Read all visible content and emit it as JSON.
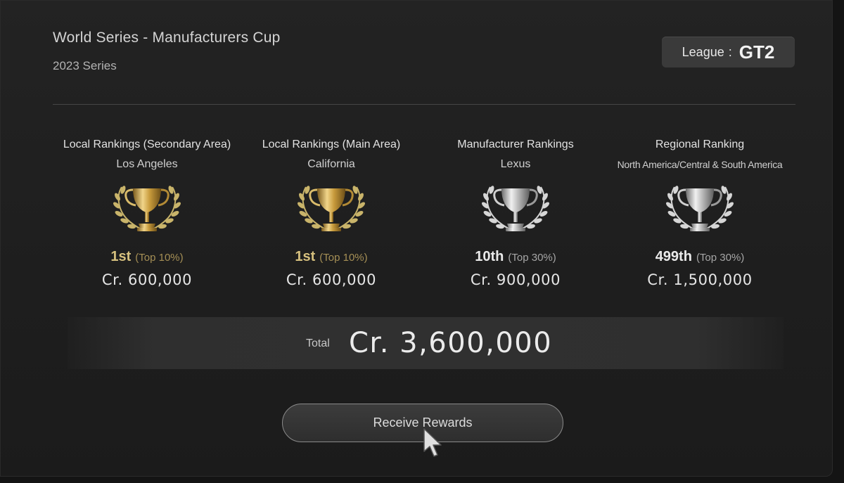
{
  "header": {
    "title": "World Series - Manufacturers Cup",
    "subtitle": "2023 Series",
    "league_label": "League",
    "league_colon": ":",
    "league_value": "GT2"
  },
  "rankings": [
    {
      "heading": "Local Rankings (Secondary Area)",
      "area": "Los Angeles",
      "trophy": "gold-trophy-icon",
      "position": "1st",
      "percentile": "(Top 10%)",
      "reward": "Cr. 600,000"
    },
    {
      "heading": "Local Rankings (Main Area)",
      "area": "California",
      "trophy": "gold-trophy-icon",
      "position": "1st",
      "percentile": "(Top 10%)",
      "reward": "Cr. 600,000"
    },
    {
      "heading": "Manufacturer Rankings",
      "area": "Lexus",
      "trophy": "silver-trophy-icon",
      "position": "10th",
      "percentile": "(Top 30%)",
      "reward": "Cr. 900,000"
    },
    {
      "heading": "Regional Ranking",
      "area": "North America/Central & South America",
      "trophy": "silver-trophy-icon",
      "position": "499th",
      "percentile": "(Top 30%)",
      "reward": "Cr. 1,500,000"
    }
  ],
  "total": {
    "label": "Total",
    "value": "Cr. 3,600,000"
  },
  "actions": {
    "receive_rewards": "Receive Rewards"
  },
  "colors": {
    "gold": "#d6c07e",
    "silver": "#d8d8d8",
    "background": "#1e1e1e"
  }
}
